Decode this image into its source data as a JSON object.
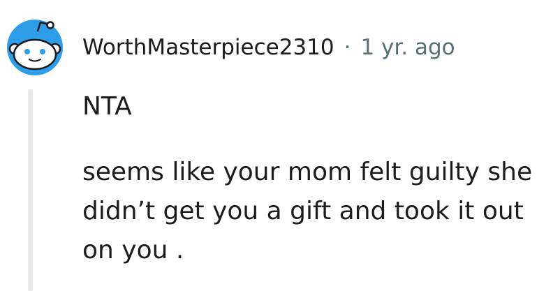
{
  "comment": {
    "username": "WorthMasterpiece2310",
    "separator": "·",
    "timestamp": "1 yr. ago",
    "paragraphs": [
      "NTA",
      "seems like your mom felt guilty she didn’t get you a gift and took it out on you ."
    ],
    "avatar_icon": "reddit-snoo-icon",
    "colors": {
      "avatar_bg": "#2e9de9",
      "meta_text": "#576f76",
      "thread_line": "#e5ebee"
    }
  }
}
